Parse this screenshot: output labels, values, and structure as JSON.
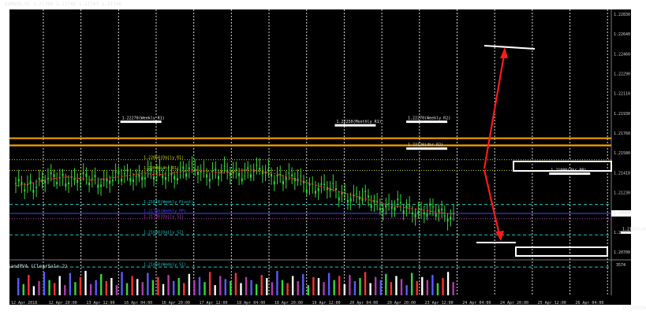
{
  "window": {
    "title": "EURUSD,H1  1.21760 1.21745 1.21767 1.21746",
    "indicator_title": "SandPVA  (ClearSale 2)",
    "indicator_value": "3574"
  },
  "colors": {
    "background": "#000000",
    "grid": "#d8d8d8",
    "candle": "#37d637",
    "ma": "#ff2d2d",
    "arrow": "#ff1a1a",
    "orange": "#f3a000",
    "yellow": "#d8d800",
    "cyan": "#19c5c5",
    "magenta": "#b23ab2",
    "blue": "#4a4aff",
    "white": "#ffffff"
  },
  "chart_data": {
    "type": "candlestick",
    "title": "EURUSD,H1",
    "ylim": [
      1.215,
      1.229
    ],
    "y_ticks": [
      "1.22830",
      "1.22640",
      "1.22460",
      "1.22290",
      "1.22110",
      "1.21930",
      "1.21760",
      "1.21580",
      "1.21410",
      "1.21230",
      "1.21050",
      "1.20880",
      "1.20700"
    ],
    "x_ticks": [
      "12 Apr 2018",
      "12 Apr 20:00",
      "13 Apr 12:00",
      "16 Apr 04:00",
      "16 Apr 20:00",
      "17 Apr 12:00",
      "18 Apr 04:00",
      "18 Apr 20:00",
      "19 Apr 12:00",
      "20 Apr 04:00",
      "20 Apr 20:00",
      "23 Apr 12:00",
      "24 Apr 04:00",
      "24 Apr 20:00",
      "25 Apr 12:00",
      "26 Apr 04:00"
    ],
    "close_path": [
      1.2191,
      1.2192,
      1.2194,
      1.2195,
      1.2196,
      1.2195,
      1.2194,
      1.2195,
      1.2196,
      1.2197,
      1.2198,
      1.2197,
      1.2198,
      1.2199,
      1.22,
      1.2199,
      1.2198,
      1.2199,
      1.22,
      1.2199,
      1.2198,
      1.2196,
      1.2194,
      1.2192,
      1.219,
      1.2188,
      1.2186,
      1.2184,
      1.2182,
      1.218,
      1.2179,
      1.2178,
      1.2177,
      1.2176,
      1.2175
    ],
    "levels": [
      {
        "price": 1.2218,
        "color": "orange",
        "style": "solid",
        "label": ""
      },
      {
        "price": 1.2214,
        "color": "orange",
        "style": "solid",
        "label": ""
      },
      {
        "price": 1.2206,
        "color": "yellow",
        "style": "dotted",
        "label": "1.22064(Daily R1)"
      },
      {
        "price": 1.22,
        "color": "yellow",
        "style": "dotted",
        "label": "1.22000(4hr R1)"
      },
      {
        "price": 1.2181,
        "color": "cyan",
        "style": "dashed",
        "label": "1.21810(Weekly Pivot)"
      },
      {
        "price": 1.2176,
        "color": "blue",
        "style": "solid",
        "label": "1.21760(Weekly PP)"
      },
      {
        "price": 1.2173,
        "color": "magenta",
        "style": "dotted",
        "label": "1.21730(Daily S1)"
      },
      {
        "price": 1.2164,
        "color": "cyan",
        "style": "dashed",
        "label": "1.21640(Daily S2)"
      },
      {
        "price": 1.2146,
        "color": "cyan",
        "style": "dashed",
        "label": "1.21460(Weekly S1)"
      }
    ],
    "markers": [
      {
        "x_index": 2,
        "price": 1.2227,
        "label": "1.22270(Weekly R1)"
      },
      {
        "x_index": 8,
        "price": 1.2225,
        "label": "1.22250(Monthly R1)"
      },
      {
        "x_index": 10,
        "price": 1.2227,
        "label": "1.22270(Weekly R2)"
      },
      {
        "x_index": 10,
        "price": 1.2212,
        "label": "1.22120(4hr R2)"
      },
      {
        "x_index": 14,
        "price": 1.2198,
        "label": "1.21980(4hr PP)"
      },
      {
        "x_index": 16,
        "price": 1.2165,
        "label": "1.21650(4hr S2)"
      },
      {
        "x_index": 16,
        "price": 1.2121,
        "label": "1.21210(Daily S3)"
      }
    ],
    "volume": [
      34,
      22,
      40,
      18,
      28,
      46,
      30,
      24,
      38,
      20,
      44,
      26,
      36,
      48,
      22,
      30,
      42,
      28,
      34,
      20,
      46,
      24,
      38,
      32,
      26,
      44,
      30,
      36,
      22,
      40,
      28,
      34,
      24,
      42,
      30,
      36,
      26,
      46,
      20,
      38,
      32,
      28,
      44,
      24,
      36,
      30,
      22,
      40,
      34,
      26,
      48,
      30,
      24,
      38,
      28,
      42,
      20,
      36,
      34,
      26,
      44,
      30,
      38,
      22,
      40,
      28,
      34,
      46,
      24,
      36,
      30,
      42,
      26,
      38,
      32,
      20,
      44,
      28,
      36,
      30,
      40,
      24,
      34,
      46,
      26
    ]
  }
}
